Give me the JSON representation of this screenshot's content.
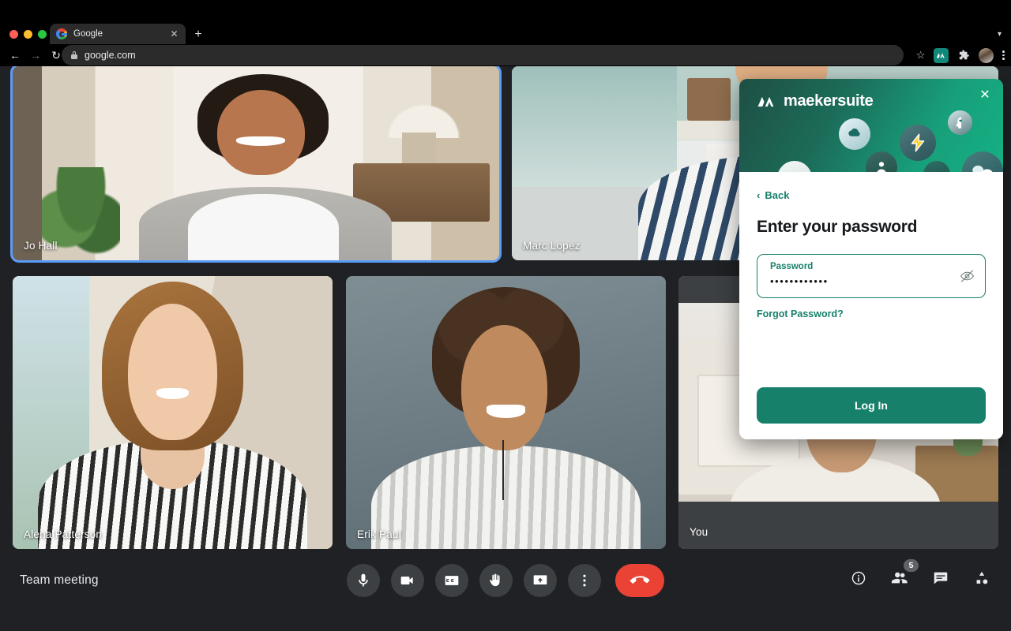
{
  "browser": {
    "tab": {
      "title": "Google",
      "favicon_icon": "google-icon",
      "close_icon": "close-icon"
    },
    "new_tab_icon": "plus-icon",
    "nav": {
      "back_icon": "arrow-left-icon",
      "forward_icon": "arrow-right-icon",
      "reload_icon": "reload-icon"
    },
    "omnibox": {
      "url": "google.com",
      "lock_icon": "lock-icon"
    },
    "toolbar_icons": [
      "star-icon",
      "maekersuite-extension-icon",
      "puzzle-extension-icon",
      "profile-avatar-icon",
      "chrome-menu-icon"
    ]
  },
  "meeting": {
    "title": "Team meeting",
    "participants": [
      {
        "name": "Jo Hall",
        "speaking": true
      },
      {
        "name": "Marc Lopez",
        "speaking": false
      },
      {
        "name": "Alena Patterson",
        "speaking": false
      },
      {
        "name": "Erik Paul",
        "speaking": false
      },
      {
        "name": "You",
        "speaking": false
      }
    ],
    "controls": [
      {
        "name": "microphone",
        "icon": "microphone-icon",
        "label": "Turn off microphone"
      },
      {
        "name": "camera",
        "icon": "video-camera-icon",
        "label": "Turn off camera"
      },
      {
        "name": "captions",
        "icon": "closed-captions-icon",
        "label": "Turn on captions"
      },
      {
        "name": "raise-hand",
        "icon": "raised-hand-icon",
        "label": "Raise hand"
      },
      {
        "name": "present",
        "icon": "present-screen-icon",
        "label": "Present now"
      },
      {
        "name": "more-options",
        "icon": "more-vertical-icon",
        "label": "More options"
      },
      {
        "name": "end-call",
        "icon": "end-call-icon",
        "label": "Leave call"
      }
    ],
    "right_controls": [
      {
        "name": "meeting-details",
        "icon": "info-icon",
        "badge": ""
      },
      {
        "name": "participants",
        "icon": "people-icon",
        "badge": "5"
      },
      {
        "name": "chat",
        "icon": "chat-bubble-icon",
        "badge": ""
      },
      {
        "name": "activities",
        "icon": "activities-icon",
        "badge": ""
      }
    ]
  },
  "popup": {
    "brand": "maekersuite",
    "logo_icon": "maekersuite-logo-icon",
    "close_icon": "close-icon",
    "back_label": "Back",
    "back_icon": "chevron-left-icon",
    "title": "Enter your password",
    "password_field": {
      "label": "Password",
      "value": "••••••••••••",
      "toggle_icon": "eye-off-icon"
    },
    "forgot_label": "Forgot Password?",
    "submit_label": "Log In",
    "colors": {
      "accent": "#17806b",
      "header_gradient_from": "#1e4f45",
      "header_gradient_to": "#16b083"
    },
    "header_bubbles": [
      "cloud-icon",
      "lightning-bolt-icon",
      "head-heart-icon",
      "person-icon",
      "speech-bubbles-icon",
      "smiley-icon",
      "target-icon"
    ]
  }
}
